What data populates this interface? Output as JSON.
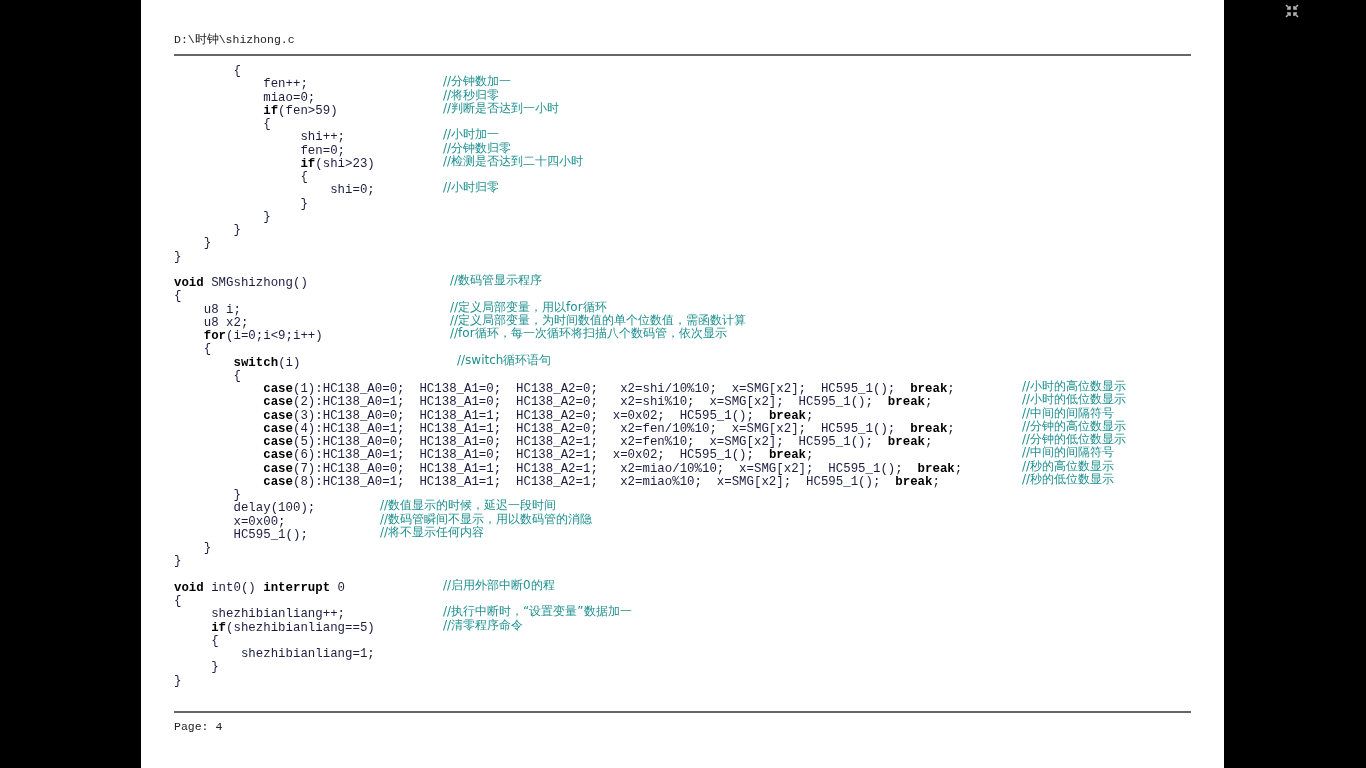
{
  "document": {
    "file_path": "D:\\时钟\\shizhong.c",
    "blocks": [
      {
        "lines": [
          {
            "code": "        {"
          },
          {
            "code": "            fen++;",
            "comment": "//分钟数加一"
          },
          {
            "code": "            miao=0;",
            "comment": "//将秒归零"
          },
          {
            "code": "            **if**(fen>59)",
            "comment": "//判断是否达到一小时"
          },
          {
            "code": "            {"
          },
          {
            "code": "                 shi++;",
            "comment": "//小时加一"
          },
          {
            "code": "                 fen=0;",
            "comment": "//分钟数归零"
          },
          {
            "code": "                 **if**(shi>23)",
            "comment": "//检测是否达到二十四小时"
          },
          {
            "code": "                 {"
          },
          {
            "code": "                     shi=0;",
            "comment": "//小时归零"
          },
          {
            "code": "                 }"
          },
          {
            "code": "            }"
          },
          {
            "code": "        }"
          },
          {
            "code": "    }"
          },
          {
            "code": "}"
          }
        ]
      },
      {
        "lines": [
          {
            "code": "**void** SMGshizhong()",
            "comment": "//数码管显示程序"
          },
          {
            "code": "{"
          },
          {
            "code": "    u8 i;",
            "comment": "//定义局部变量，用以for循环"
          },
          {
            "code": "    u8 x2;",
            "comment": "//定义局部变量，为时间数值的单个位数值，需函数计算"
          },
          {
            "code": "    **for**(i=0;i<9;i++)",
            "comment": "//for循环，每一次循环将扫描八个数码管，依次显示"
          },
          {
            "code": "    {"
          },
          {
            "code": "        **switch**(i)",
            "comment": "//switch循环语句"
          },
          {
            "code": "        {"
          },
          {
            "code": "            **case**(1):HC138_A0=0;  HC138_A1=0;  HC138_A2=0;   x2=shi/10%10;  x=SMG[x2];  HC595_1();  **break**;",
            "comment": "//小时的高位数显示"
          },
          {
            "code": "            **case**(2):HC138_A0=1;  HC138_A1=0;  HC138_A2=0;   x2=shi%10;  x=SMG[x2];  HC595_1();  **break**;",
            "comment": "//小时的低位数显示"
          },
          {
            "code": "            **case**(3):HC138_A0=0;  HC138_A1=1;  HC138_A2=0;  x=0x02;  HC595_1();  **break**;",
            "comment": "//中间的间隔符号"
          },
          {
            "code": "            **case**(4):HC138_A0=1;  HC138_A1=1;  HC138_A2=0;   x2=fen/10%10;  x=SMG[x2];  HC595_1();  **break**;",
            "comment": "//分钟的高位数显示"
          },
          {
            "code": "            **case**(5):HC138_A0=0;  HC138_A1=0;  HC138_A2=1;   x2=fen%10;  x=SMG[x2];  HC595_1();  **break**;",
            "comment": "//分钟的低位数显示"
          },
          {
            "code": "            **case**(6):HC138_A0=1;  HC138_A1=0;  HC138_A2=1;  x=0x02;  HC595_1();  **break**;",
            "comment": "//中间的间隔符号"
          },
          {
            "code": "            **case**(7):HC138_A0=0;  HC138_A1=1;  HC138_A2=1;   x2=miao/10%10;  x=SMG[x2];  HC595_1();  **break**;",
            "comment": "//秒的高位数显示"
          },
          {
            "code": "            **case**(8):HC138_A0=1;  HC138_A1=1;  HC138_A2=1;   x2=miao%10;  x=SMG[x2];  HC595_1();  **break**;",
            "comment": "//秒的低位数显示"
          },
          {
            "code": "        }"
          },
          {
            "code": "        delay(100);",
            "comment": "//数值显示的时候，延迟一段时间"
          },
          {
            "code": "        x=0x00;",
            "comment": "//数码管瞬间不显示，用以数码管的消隐"
          },
          {
            "code": "        HC595_1();",
            "comment": "//将不显示任何内容"
          },
          {
            "code": "    }"
          },
          {
            "code": "}"
          }
        ]
      },
      {
        "lines": [
          {
            "code": "**void** int0() **interrupt** 0",
            "comment": "//启用外部中断0的程"
          },
          {
            "code": "{"
          },
          {
            "code": "     shezhibianliang++;",
            "comment": "//执行中断时，“设置变量”数据加一"
          },
          {
            "code": "     **if**(shezhibianliang==5)",
            "comment": "//清零程序命令"
          },
          {
            "code": "     {"
          },
          {
            "code": "         shezhibianliang=1;"
          },
          {
            "code": "     }"
          },
          {
            "code": "}"
          }
        ]
      }
    ],
    "page_label": "Page: 4"
  }
}
